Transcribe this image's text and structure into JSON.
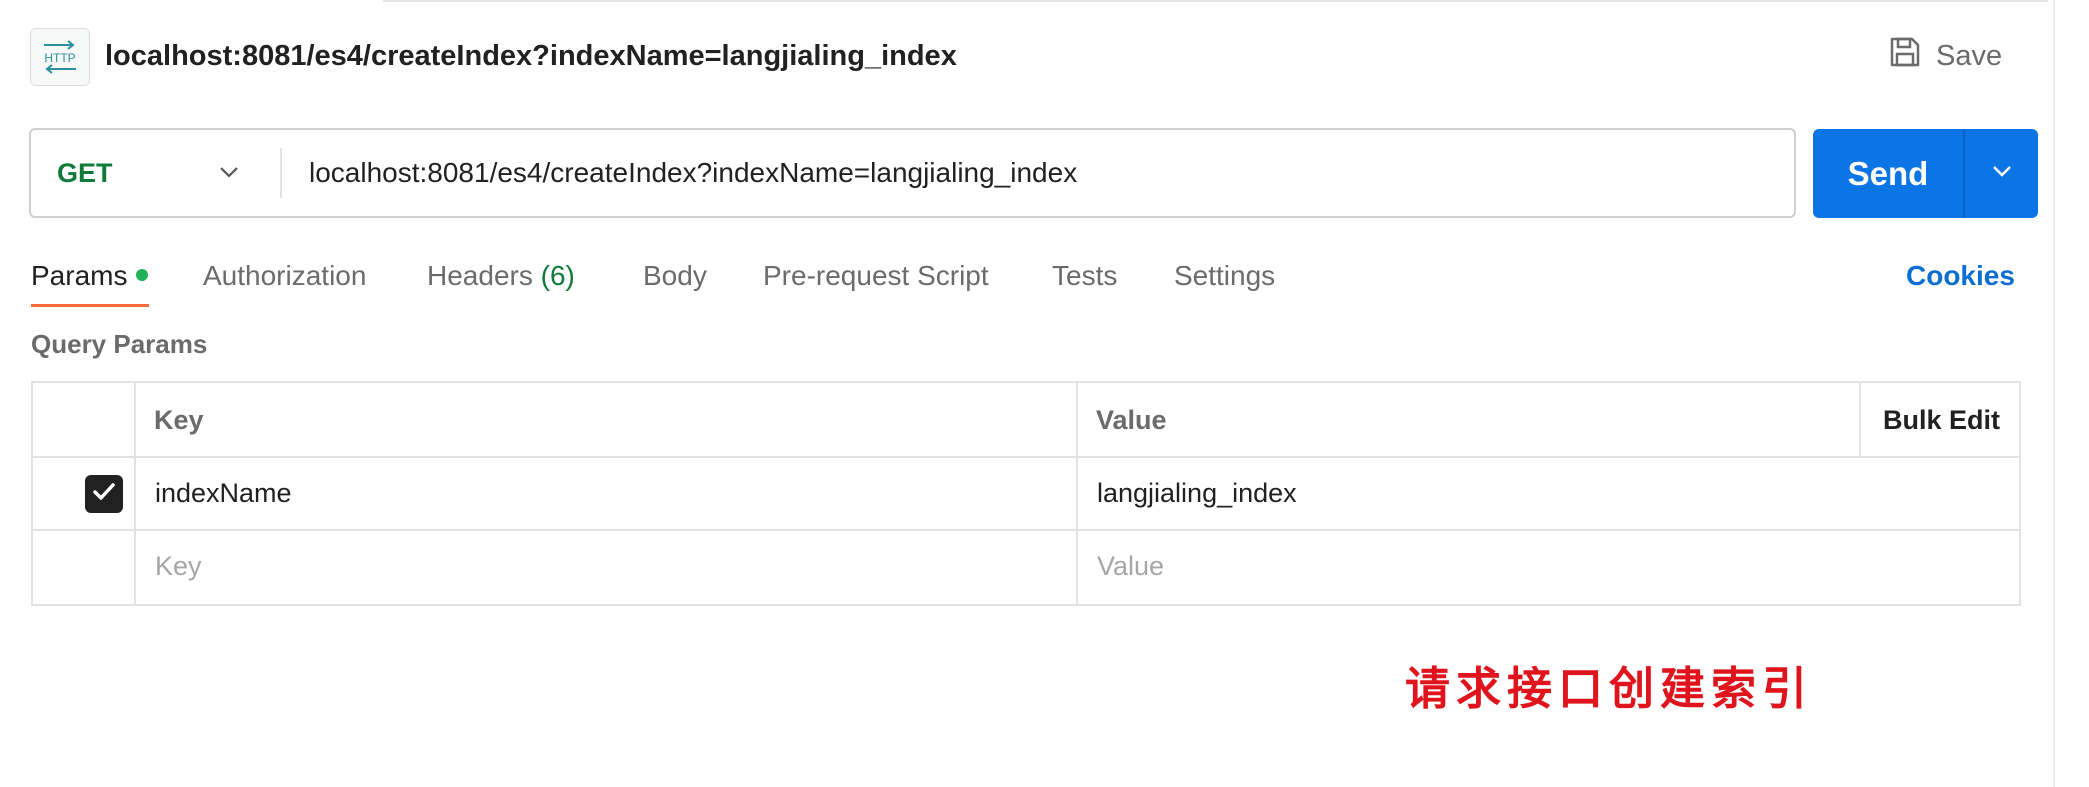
{
  "request": {
    "title": "localhost:8081/es4/createIndex?indexName=langjialing_index",
    "badge_icon": "http-icon",
    "save_label": "Save",
    "method": "GET",
    "url": "localhost:8081/es4/createIndex?indexName=langjialing_index",
    "send_label": "Send"
  },
  "tabs": [
    {
      "label": "Params",
      "active": true,
      "has_dot": true
    },
    {
      "label": "Authorization"
    },
    {
      "label": "Headers",
      "count": "(6)"
    },
    {
      "label": "Body"
    },
    {
      "label": "Pre-request Script"
    },
    {
      "label": "Tests"
    },
    {
      "label": "Settings"
    }
  ],
  "cookies_label": "Cookies",
  "query_params": {
    "title": "Query Params",
    "headers": {
      "key": "Key",
      "value": "Value",
      "bulk_edit": "Bulk Edit"
    },
    "rows": [
      {
        "checked": true,
        "key": "indexName",
        "value": "langjialing_index"
      }
    ],
    "placeholder": {
      "key": "Key",
      "value": "Value"
    }
  },
  "annotation": "请求接口创建索引",
  "colors": {
    "method_get": "#0f7b3a",
    "send_button": "#0c75e6",
    "active_tab_underline": "#ff6c37",
    "params_dot": "#20b15a",
    "cookies_link": "#0c6ed3",
    "annotation": "#e0141c"
  }
}
